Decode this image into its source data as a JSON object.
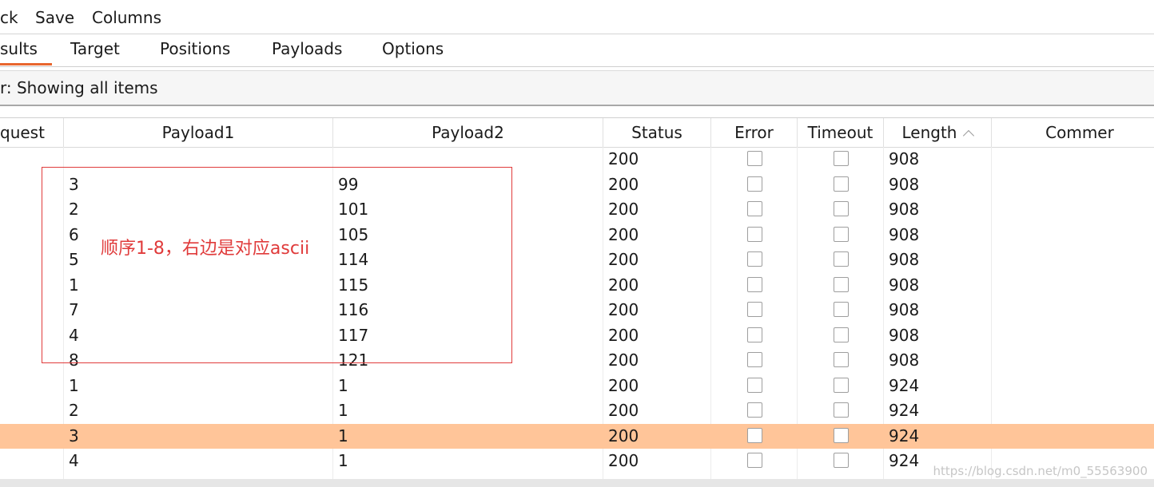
{
  "menubar": {
    "items": [
      "ck",
      "Save",
      "Columns"
    ]
  },
  "tabs": [
    "sults",
    "Target",
    "Positions",
    "Payloads",
    "Options"
  ],
  "filter": {
    "text": "r: Showing all items"
  },
  "table": {
    "columns": [
      "quest",
      "Payload1",
      "Payload2",
      "Status",
      "Error",
      "Timeout",
      "Length",
      "Commer"
    ],
    "sorted_column": "Length",
    "sort_direction": "ascending",
    "rows": [
      {
        "payload1": "",
        "payload2": "",
        "status": "200",
        "error": false,
        "timeout": false,
        "length": "908"
      },
      {
        "payload1": "3",
        "payload2": "99",
        "status": "200",
        "error": false,
        "timeout": false,
        "length": "908"
      },
      {
        "payload1": "2",
        "payload2": "101",
        "status": "200",
        "error": false,
        "timeout": false,
        "length": "908"
      },
      {
        "payload1": "6",
        "payload2": "105",
        "status": "200",
        "error": false,
        "timeout": false,
        "length": "908"
      },
      {
        "payload1": "5",
        "payload2": "114",
        "status": "200",
        "error": false,
        "timeout": false,
        "length": "908"
      },
      {
        "payload1": "1",
        "payload2": "115",
        "status": "200",
        "error": false,
        "timeout": false,
        "length": "908"
      },
      {
        "payload1": "7",
        "payload2": "116",
        "status": "200",
        "error": false,
        "timeout": false,
        "length": "908"
      },
      {
        "payload1": "4",
        "payload2": "117",
        "status": "200",
        "error": false,
        "timeout": false,
        "length": "908"
      },
      {
        "payload1": "8",
        "payload2": "121",
        "status": "200",
        "error": false,
        "timeout": false,
        "length": "908"
      },
      {
        "payload1": "1",
        "payload2": "1",
        "status": "200",
        "error": false,
        "timeout": false,
        "length": "924"
      },
      {
        "payload1": "2",
        "payload2": "1",
        "status": "200",
        "error": false,
        "timeout": false,
        "length": "924"
      },
      {
        "payload1": "3",
        "payload2": "1",
        "status": "200",
        "error": false,
        "timeout": false,
        "length": "924",
        "selected": true
      },
      {
        "payload1": "4",
        "payload2": "1",
        "status": "200",
        "error": false,
        "timeout": false,
        "length": "924"
      }
    ]
  },
  "annotation": {
    "text": "顺序1-8，右边是对应ascii",
    "color": "#e03b3b"
  },
  "colors": {
    "selected_row": "#ffc599",
    "active_tab_underline": "#e8662e"
  },
  "watermark": "https://blog.csdn.net/m0_55563900"
}
